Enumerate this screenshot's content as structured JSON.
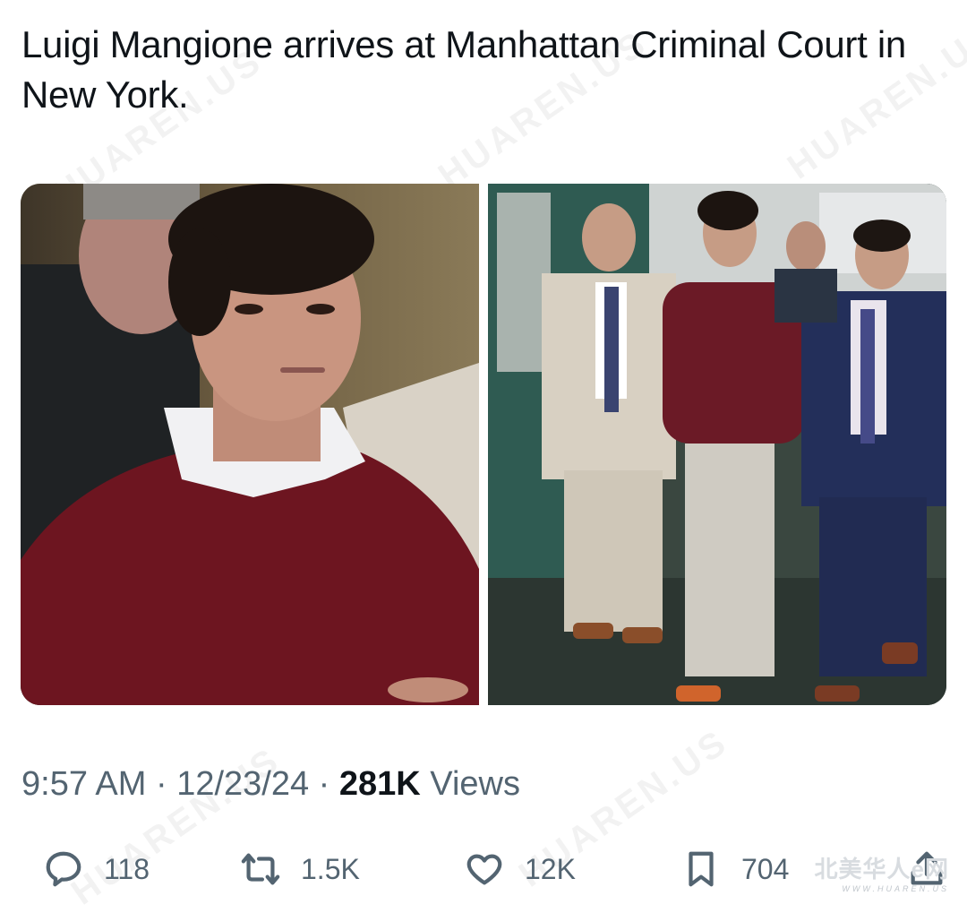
{
  "tweet": {
    "text": "Luigi Mangione arrives at Manhattan Criminal Court in New York."
  },
  "meta": {
    "time": "9:57 AM",
    "separator": " · ",
    "date": "12/23/24",
    "views_count": "281K",
    "views_label": " Views"
  },
  "actions": {
    "replies": "118",
    "reposts": "1.5K",
    "likes": "12K",
    "bookmarks": "704"
  },
  "watermark": {
    "brand": "北美华人e网",
    "url": "WWW.HUAREN.US",
    "background_text": "HUAREN.US"
  },
  "icons": {
    "reply": "reply-icon",
    "repost": "repost-icon",
    "like": "heart-icon",
    "bookmark": "bookmark-icon",
    "share": "share-icon"
  },
  "colors": {
    "text": "#0f1419",
    "secondary": "#536471",
    "background": "#ffffff"
  }
}
